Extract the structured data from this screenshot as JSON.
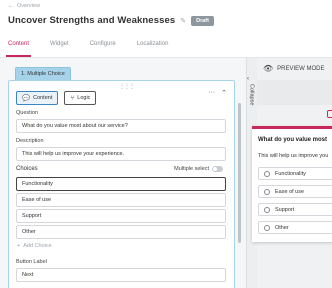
{
  "breadcrumb": {
    "back_arrow": "←",
    "label": "Overview"
  },
  "header": {
    "title": "Uncover Strengths and Weaknesses",
    "status_badge": "Draft"
  },
  "tabs": [
    {
      "label": "Content",
      "active": true
    },
    {
      "label": "Widget",
      "active": false
    },
    {
      "label": "Configure",
      "active": false
    },
    {
      "label": "Localization",
      "active": false
    }
  ],
  "step": {
    "label": "1. Multiple Choice"
  },
  "editor": {
    "content_button": "Content",
    "logic_button": "Logic",
    "question_label": "Question",
    "question_value": "What do you value most about our service?",
    "description_label": "Description",
    "description_value": "This will help us improve your experience.",
    "choices_label": "Choices",
    "multiple_select_label": "Multiple select",
    "multiple_select_on": false,
    "choices": [
      "Functionality",
      "Ease of use",
      "Support",
      "Other"
    ],
    "add_choice": "Add Choice",
    "button_label_label": "Button Label",
    "button_label_value": "Next"
  },
  "collapse": {
    "label": "Collapse"
  },
  "preview": {
    "mode_label": "PREVIEW MODE",
    "question": "What do you value most",
    "description": "This will help us improve you",
    "options": [
      "Functionality",
      "Ease of use",
      "Support",
      "Other"
    ]
  },
  "colors": {
    "accent": "#c8285a",
    "step_tab": "#a6d3ea",
    "active_button": "#3b86c4"
  }
}
